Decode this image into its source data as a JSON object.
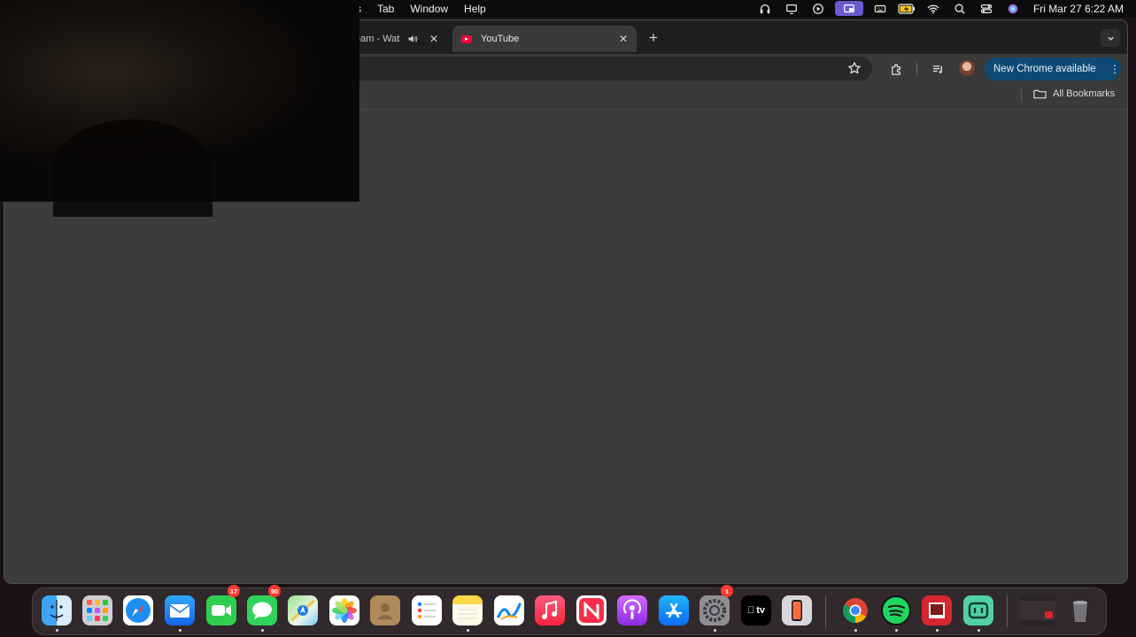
{
  "menubar": {
    "partial_item": "s",
    "items": [
      "Tab",
      "Window",
      "Help"
    ],
    "clock": "Fri Mar 27  6:22 AM",
    "status_icons": [
      "headphones-icon",
      "display-icon",
      "play-icon",
      "screen-share-icon",
      "keyboard-icon",
      "battery-icon",
      "wifi-icon",
      "search-icon",
      "control-center-icon",
      "siri-icon"
    ]
  },
  "browser": {
    "tabs": [
      {
        "title": "eam - Wat",
        "audio": true,
        "active": false
      },
      {
        "title": "YouTube",
        "active": true
      }
    ],
    "new_tab_label": "+",
    "update_button": "New Chrome available",
    "bookmarks": {
      "all_label": "All Bookmarks"
    }
  },
  "dock": {
    "apps": [
      {
        "name": "Finder",
        "icon": "finder-icon",
        "running": true
      },
      {
        "name": "Launchpad",
        "icon": "launchpad-icon"
      },
      {
        "name": "Safari",
        "icon": "safari-icon"
      },
      {
        "name": "Mail",
        "icon": "mail-icon",
        "running": true
      },
      {
        "name": "FaceTime",
        "icon": "facetime-icon",
        "badge": "17"
      },
      {
        "name": "Messages",
        "icon": "messages-icon",
        "badge": "90",
        "running": true
      },
      {
        "name": "Maps",
        "icon": "maps-icon"
      },
      {
        "name": "Photos",
        "icon": "photos-icon"
      },
      {
        "name": "Contacts",
        "icon": "contacts-icon"
      },
      {
        "name": "Reminders",
        "icon": "reminders-icon"
      },
      {
        "name": "Notes",
        "icon": "notes-icon",
        "running": true
      },
      {
        "name": "Freeform",
        "icon": "freeform-icon"
      },
      {
        "name": "Music",
        "icon": "music-icon"
      },
      {
        "name": "News",
        "icon": "news-icon"
      },
      {
        "name": "Podcasts",
        "icon": "podcasts-icon"
      },
      {
        "name": "App Store",
        "icon": "app-store-icon"
      },
      {
        "name": "System Settings",
        "icon": "settings-icon",
        "badge": "1",
        "running": true
      },
      {
        "name": "TV",
        "icon": "tv-icon",
        "label": "tv"
      },
      {
        "name": "iPhone Mirroring",
        "icon": "iphone-mirroring-icon"
      },
      {
        "name": "Chrome",
        "icon": "chrome-icon",
        "running": true
      },
      {
        "name": "Spotify",
        "icon": "spotify-icon",
        "running": true
      },
      {
        "name": "Photo Booth",
        "icon": "photo-booth-icon",
        "running": true
      },
      {
        "name": "Screen Studio",
        "icon": "screen-studio-icon",
        "running": true
      },
      {
        "name": "Recent Window",
        "icon": "window-thumbnail-icon"
      },
      {
        "name": "Trash",
        "icon": "trash-icon"
      }
    ]
  }
}
